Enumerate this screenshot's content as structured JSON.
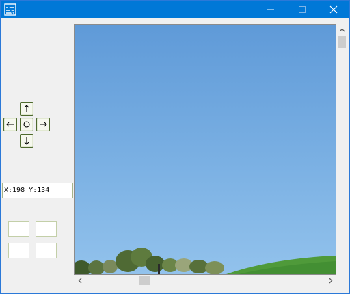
{
  "window": {
    "app_icon": "app-logo-icon",
    "controls": [
      "minimize-icon",
      "maximize-icon",
      "close-icon"
    ]
  },
  "dpad": {
    "up": "arrow-up-icon",
    "left": "arrow-left-icon",
    "center": "circle-icon",
    "right": "arrow-right-icon",
    "down": "arrow-down-icon"
  },
  "coordinates": {
    "text": "X:198 Y:134"
  },
  "colors": {
    "titlebar": "#0078d7",
    "sky": "#7db2e4",
    "grass": "#4f9a3a"
  }
}
